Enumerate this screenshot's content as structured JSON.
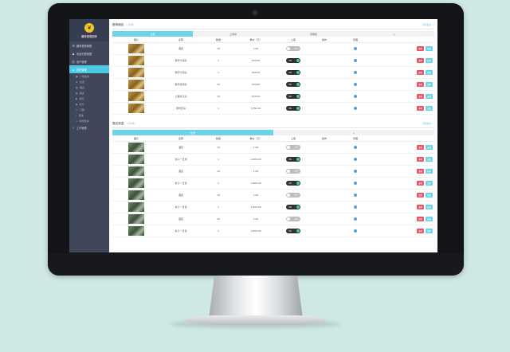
{
  "brand": {
    "name": "趣味爸爸团体"
  },
  "sidebar": {
    "items": [
      {
        "label": "趣味爸爸管理",
        "icon": "list-icon"
      },
      {
        "label": "商品列表管理",
        "icon": "user-icon"
      },
      {
        "label": "用户管理",
        "icon": "person-icon"
      },
      {
        "label": "首页管理",
        "icon": "home-icon",
        "active": true
      }
    ],
    "sub_items": [
      {
        "label": "广告板块",
        "icon": "image-icon"
      },
      {
        "label": "优选",
        "icon": "star-icon"
      },
      {
        "label": "酒店",
        "icon": "hotel-icon"
      },
      {
        "label": "美食",
        "icon": "food-icon"
      },
      {
        "label": "游玩",
        "icon": "play-icon"
      },
      {
        "label": "出行",
        "icon": "car-icon"
      },
      {
        "label": "门票",
        "icon": "ticket-icon"
      },
      {
        "label": "其他",
        "icon": "dot-icon"
      },
      {
        "label": "新增模块",
        "icon": "plus-icon"
      }
    ],
    "bottom_items": [
      {
        "label": "工作管理",
        "icon": "check-icon"
      }
    ]
  },
  "section1": {
    "title": "推荐酒店",
    "subtitle": "(共6条)",
    "more": "查看更多>>",
    "tabs": [
      {
        "label": "全部",
        "active": true
      },
      {
        "label": "上线中",
        "active": false
      },
      {
        "label": "待审核",
        "active": false
      },
      {
        "label": "+",
        "active": false
      }
    ],
    "headers": [
      "图片",
      "名称",
      "数量",
      "单价（元）",
      "上架",
      "操作",
      "管理",
      ""
    ],
    "rows": [
      {
        "name": "酒店",
        "qty": "10",
        "price": "1.00",
        "toggle": "off",
        "toggle_label": "OFF"
      },
      {
        "name": "豪华大床房",
        "qty": "1",
        "price": "500.00",
        "toggle": "on",
        "toggle_label": "ON"
      },
      {
        "name": "豪华大床房",
        "qty": "1",
        "price": "500.00",
        "toggle": "on",
        "toggle_label": "ON"
      },
      {
        "name": "豪华双床房",
        "qty": "10",
        "price": "500.00",
        "toggle": "on",
        "toggle_label": "ON"
      },
      {
        "name": "儿童亲子房",
        "qty": "10",
        "price": "500.00",
        "toggle": "on",
        "toggle_label": "ON"
      },
      {
        "name": "豪华套房",
        "qty": "1",
        "price": "1780.00",
        "toggle": "on",
        "toggle_label": "ON"
      }
    ]
  },
  "section2": {
    "title": "周边旅游",
    "subtitle": "(共10条)",
    "more": "查看更多>>",
    "tabs": [
      {
        "label": "全部",
        "active": true
      },
      {
        "label": "+",
        "active": false
      }
    ],
    "headers": [
      "图片",
      "名称",
      "数量",
      "单价（元）",
      "上架",
      "操作",
      "管理",
      ""
    ],
    "rows": [
      {
        "name": "酒店",
        "qty": "10",
        "price": "1.00",
        "toggle": "off",
        "toggle_label": "OFF"
      },
      {
        "name": "亲子一日游",
        "qty": "1",
        "price": "1,800.00",
        "toggle": "on",
        "toggle_label": "ON"
      },
      {
        "name": "酒店",
        "qty": "10",
        "price": "1.00",
        "toggle": "off",
        "toggle_label": "OFF"
      },
      {
        "name": "亲子一日游",
        "qty": "1",
        "price": "1,800.00",
        "toggle": "on",
        "toggle_label": "ON"
      },
      {
        "name": "酒店",
        "qty": "10",
        "price": "1.00",
        "toggle": "off",
        "toggle_label": "OFF"
      },
      {
        "name": "亲子一日游",
        "qty": "1",
        "price": "1,800.00",
        "toggle": "on",
        "toggle_label": "ON"
      },
      {
        "name": "酒店",
        "qty": "10",
        "price": "1.00",
        "toggle": "off",
        "toggle_label": "OFF"
      },
      {
        "name": "亲子一日游",
        "qty": "1",
        "price": "1,800.00",
        "toggle": "on",
        "toggle_label": "ON"
      }
    ]
  },
  "row_actions": {
    "delete_label": "删除",
    "edit_label": "编辑"
  },
  "colors": {
    "accent": "#6cd3ea",
    "sidebar": "#40475a",
    "danger": "#e5566b",
    "background": "#cfe8e4"
  }
}
